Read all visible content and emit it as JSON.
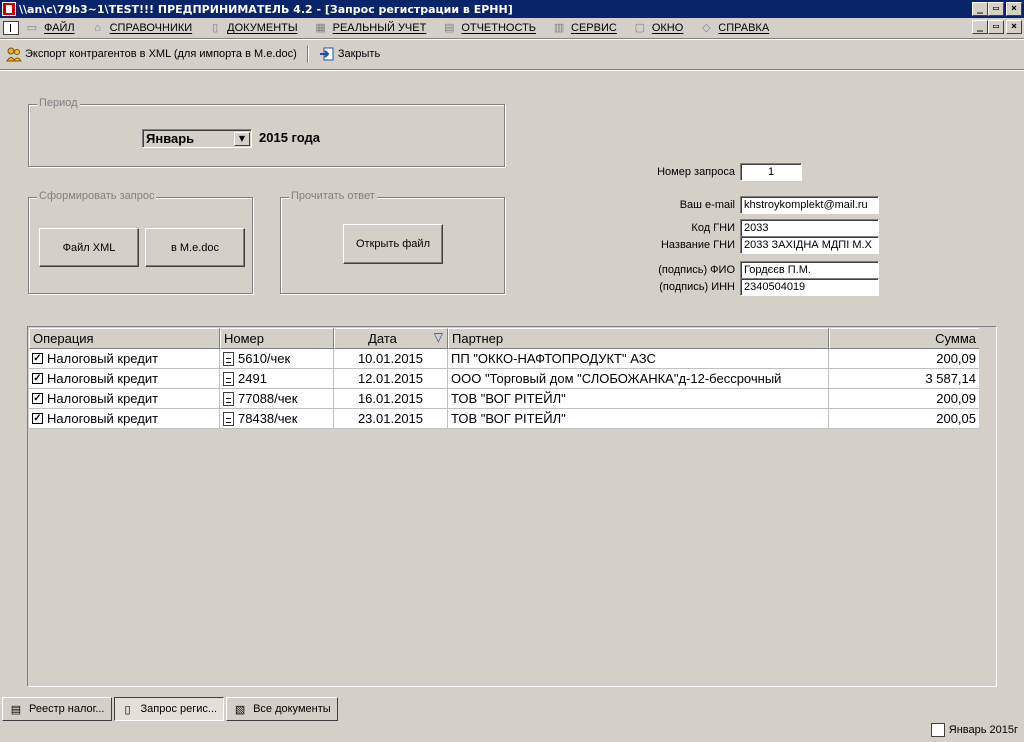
{
  "window": {
    "title": "\\\\an\\c\\79b3~1\\TEST!!!  ПРЕДПРИНИМАТЕЛЬ 4.2 - [Запрос регистрации в ЕРНН]",
    "min": "_",
    "max": "▭",
    "close": "×",
    "restore": "🗗"
  },
  "menu": [
    {
      "label": "ФАЙЛ",
      "icon": "folder-icon",
      "glyph": "▭"
    },
    {
      "label": "СПРАВОЧНИКИ",
      "icon": "house-icon",
      "glyph": "⌂"
    },
    {
      "label": "ДОКУМЕНТЫ",
      "icon": "document-icon",
      "glyph": "▯"
    },
    {
      "label": "РЕАЛЬНЫЙ УЧЕТ",
      "icon": "calendar-icon",
      "glyph": "▦"
    },
    {
      "label": "ОТЧЕТНОСТЬ",
      "icon": "report-icon",
      "glyph": "▤"
    },
    {
      "label": "СЕРВИС",
      "icon": "tools-icon",
      "glyph": "▥"
    },
    {
      "label": "ОКНО",
      "icon": "window-icon",
      "glyph": "▢"
    },
    {
      "label": "СПРАВКА",
      "icon": "help-icon",
      "glyph": "◇"
    }
  ],
  "toolbar": {
    "export_label": "Экспорт контрагентов в XML (для импорта в M.e.doc)",
    "close_label": "Закрыть"
  },
  "period": {
    "legend": "Период",
    "month": "Январь",
    "year_text": "2015 года"
  },
  "form_request": {
    "legend": "Сформировать запрос",
    "xml_button": "Файл XML",
    "medoc_button": "в M.e.doc"
  },
  "read_reply": {
    "legend": "Прочитать ответ",
    "open_button": "Открыть файл"
  },
  "fields": {
    "request_number_label": "Номер запроса",
    "request_number": "1",
    "email_label": "Ваш e-mail",
    "email": "khstroykomplekt@mail.ru",
    "gni_code_label": "Код ГНИ",
    "gni_code": "2033",
    "gni_name_label": "Название ГНИ",
    "gni_name": "2033 ЗАХІДНА МДПІ М.Х",
    "signer_name_label": "(подпись) ФИО",
    "signer_name": "Гордєєв П.М.",
    "signer_inn_label": "(подпись) ИНН",
    "signer_inn": "2340504019"
  },
  "grid": {
    "headers": {
      "operation": "Операция",
      "number": "Номер",
      "date": "Дата",
      "partner": "Партнер",
      "sum": "Сумма"
    },
    "sort_indicator": "▽",
    "rows": [
      {
        "operation": "Налоговый кредит",
        "number": "5610/чек",
        "date": "10.01.2015",
        "partner": "ПП \"ОККО-НАФТОПРОДУКТ\" АЗС",
        "sum": "200,09",
        "checked": "✓"
      },
      {
        "operation": "Налоговый кредит",
        "number": "2491",
        "date": "12.01.2015",
        "partner": "ООО \"Торговый дом \"СЛОБОЖАНКА\"д-12-бессрочный",
        "sum": "3 587,14",
        "checked": "✓"
      },
      {
        "operation": "Налоговый кредит",
        "number": "77088/чек",
        "date": "16.01.2015",
        "partner": "ТОВ \"ВОГ РІТЕЙЛ\"",
        "sum": "200,09",
        "checked": "✓"
      },
      {
        "operation": "Налоговый кредит",
        "number": "78438/чек",
        "date": "23.01.2015",
        "partner": "ТОВ \"ВОГ РІТЕЙЛ\"",
        "sum": "200,05",
        "checked": "✓"
      }
    ]
  },
  "tabs": [
    {
      "label": "Реестр налог...",
      "icon": "register-icon",
      "glyph": "▤"
    },
    {
      "label": "Запрос регис...",
      "icon": "document-icon",
      "glyph": "▯"
    },
    {
      "label": "Все документы",
      "icon": "documents-stack-icon",
      "glyph": "▧"
    }
  ],
  "status": {
    "period": "Январь 2015г"
  }
}
